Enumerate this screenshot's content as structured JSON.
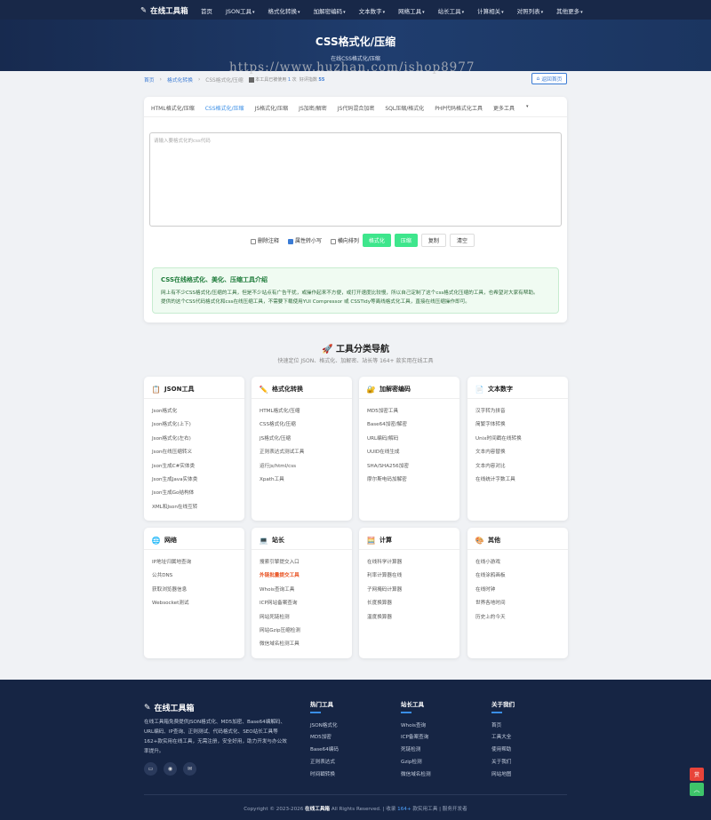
{
  "nav": {
    "brand": "在线工具箱",
    "items": [
      {
        "label": "首页",
        "dropdown": false
      },
      {
        "label": "JSON工具",
        "dropdown": true
      },
      {
        "label": "格式化转换",
        "dropdown": true
      },
      {
        "label": "加解密编码",
        "dropdown": true
      },
      {
        "label": "文本数字",
        "dropdown": true
      },
      {
        "label": "网络工具",
        "dropdown": true
      },
      {
        "label": "站长工具",
        "dropdown": true
      },
      {
        "label": "计算相关",
        "dropdown": true
      },
      {
        "label": "对照列表",
        "dropdown": true
      },
      {
        "label": "其他更多",
        "dropdown": true
      }
    ]
  },
  "hero": {
    "title": "CSS格式化/压缩",
    "subtitle": "在线CSS格式化/压缩"
  },
  "watermark": "https://www.huzhan.com/ishop8977",
  "breadcrumb": {
    "home": "首页",
    "category": "格式化转换",
    "current": "CSS格式化/压缩",
    "usage_prefix": "本工具已被使用",
    "usage_count": "1",
    "usage_unit": "次",
    "rating_label": "好评指数",
    "rating_value": "55",
    "home_button": "返回首页"
  },
  "tabs": [
    "HTML格式化/压缩",
    "CSS格式化/压缩",
    "JS格式化/压缩",
    "JS加密/解密",
    "JS代码混合加密",
    "SQL压缩/格式化",
    "PHP代码格式化工具",
    "更多工具"
  ],
  "editor": {
    "placeholder": "请输入要格式化的css代码"
  },
  "options": {
    "remove_comments": "删除注释",
    "lowercase": "属性转小写",
    "horizontal": "横向排列",
    "format_btn": "格式化",
    "compress_btn": "压缩",
    "copy_btn": "复制",
    "clear_btn": "清空"
  },
  "info": {
    "title": "CSS在线格式化、美化、压缩工具介绍",
    "line1": "网上有不少CSS格式化/压缩的工具，但是不少站点有广告干扰，或操作起来不方便，或打开速度比较慢，所以自己定制了这个css格式化压缩的工具，也希望对大家有帮助。",
    "line2": "提供的这个CSS代码格式化和css在线压缩工具，不需要下载使用YUI Compressor 或 CSSTidy等离线格式化工具，直接在线压缩操作即可。"
  },
  "tool_nav": {
    "title": "工具分类导航",
    "subtitle": "快速定位 JSON、格式化、加解密、站长等 164+ 款实用在线工具",
    "categories": [
      {
        "title": "JSON工具",
        "icon": "clipboard-icon",
        "items": [
          "Json格式化",
          "Json格式化(上下)",
          "Json格式化(左右)",
          "Json在线压缩转义",
          "Json生成C#实体类",
          "Json生成Java实体类",
          "Json生成Go结构体",
          "XML和Json在线互转"
        ],
        "hot": []
      },
      {
        "title": "格式化转换",
        "icon": "pencil-icon",
        "items": [
          "HTML格式化/压缩",
          "CSS格式化/压缩",
          "JS格式化/压缩",
          "正则表达式测试工具",
          "运行js/html/css",
          "Xpath工具"
        ],
        "hot": []
      },
      {
        "title": "加解密编码",
        "icon": "lock-icon",
        "items": [
          "MD5加密工具",
          "Base64加密/解密",
          "URL编码/解码",
          "UUID在线生成",
          "SHA/SHA256加密",
          "摩尔斯电码加解密"
        ],
        "hot": []
      },
      {
        "title": "文本数字",
        "icon": "document-icon",
        "items": [
          "汉字转为拼音",
          "简繁字体转换",
          "Unix时间戳在线转换",
          "文本内容替换",
          "文本内容对比",
          "在线统计字数工具"
        ],
        "hot": []
      },
      {
        "title": "网络",
        "icon": "globe-icon",
        "items": [
          "IP地址归属地查询",
          "公共DNS",
          "获取浏览器信息",
          "Websocket测试"
        ],
        "hot": []
      },
      {
        "title": "站长",
        "icon": "laptop-icon",
        "items": [
          "搜索引擎提交入口",
          "外链批量提交工具",
          "Whois查询工具",
          "ICP网站备案查询",
          "网站死链检测",
          "网站Gzip压缩检测",
          "微信域名检测工具"
        ],
        "hot": [
          1
        ]
      },
      {
        "title": "计算",
        "icon": "calculator-icon",
        "items": [
          "在线科学计算器",
          "利率计算器在线",
          "子网掩码计算器",
          "长度换算器",
          "温度换算器"
        ],
        "hot": []
      },
      {
        "title": "其他",
        "icon": "palette-icon",
        "items": [
          "在线小游戏",
          "在线涂鸦画板",
          "在线时钟",
          "世界各地时间",
          "历史上的今天"
        ],
        "hot": []
      }
    ]
  },
  "footer": {
    "brand": "在线工具箱",
    "desc": "在线工具箱免费提供JSON格式化、MD5加密、Base64编解码、URL编码、IP查询、正则测试、代码格式化、SEO站长工具等162+款实用在线工具，无需注册，安全好用，助力开发与办公效率提升。",
    "columns": [
      {
        "title": "热门工具",
        "links": [
          "JSON格式化",
          "MD5加密",
          "Base64编码",
          "正则表达式",
          "时间戳转换"
        ]
      },
      {
        "title": "站长工具",
        "links": [
          "Whois查询",
          "ICP备案查询",
          "死链检测",
          "Gzip检测",
          "微信域名检测"
        ]
      },
      {
        "title": "关于我们",
        "links": [
          "首页",
          "工具大全",
          "使用帮助",
          "关于我们",
          "网站地图"
        ]
      }
    ],
    "copyright_prefix": "Copyright © 2023-2026",
    "copyright_brand": "在线工具箱",
    "copyright_mid": "All Rights Reserved. | 收录",
    "tool_count": "164+",
    "copyright_suffix": "款实用工具 | 服务开发者"
  },
  "float": {
    "reward": "赏",
    "top": "︿"
  }
}
